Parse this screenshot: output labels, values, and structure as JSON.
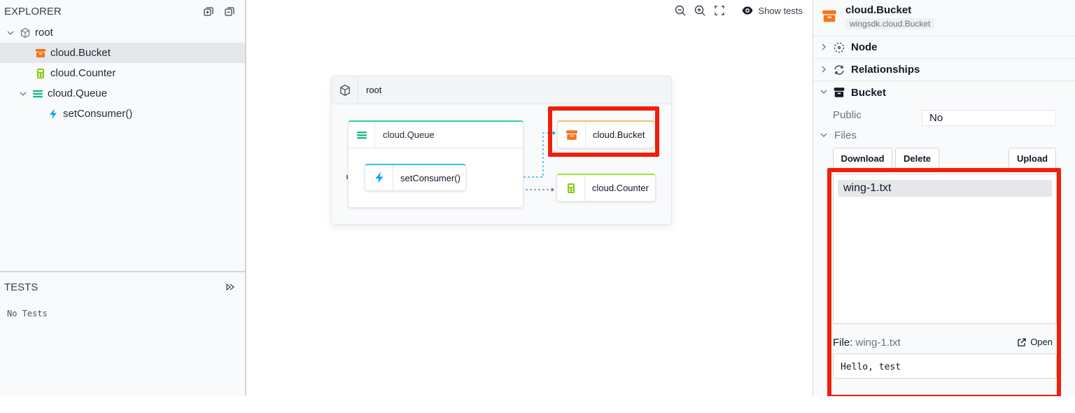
{
  "explorer": {
    "title": "EXPLORER",
    "items": [
      {
        "label": "root"
      },
      {
        "label": "cloud.Bucket"
      },
      {
        "label": "cloud.Counter"
      },
      {
        "label": "cloud.Queue"
      },
      {
        "label": "setConsumer()"
      }
    ]
  },
  "tests": {
    "title": "TESTS",
    "empty": "No Tests"
  },
  "toolbar": {
    "show_tests": "Show tests"
  },
  "map": {
    "root": "root",
    "queue": "cloud.Queue",
    "consumer": "setConsumer()",
    "bucket": "cloud.Bucket",
    "counter": "cloud.Counter"
  },
  "inspector": {
    "title": "cloud.Bucket",
    "subtitle": "wingsdk.cloud.Bucket",
    "sections": {
      "node": "Node",
      "relationships": "Relationships",
      "bucket": "Bucket"
    },
    "public_label": "Public",
    "public_value": "No",
    "files_label": "Files",
    "buttons": {
      "download": "Download",
      "delete": "Delete",
      "upload": "Upload"
    },
    "files": [
      "wing-1.txt"
    ],
    "file_prefix": "File:",
    "file_name": "wing-1.txt",
    "open": "Open",
    "file_content": "Hello, test"
  },
  "colors": {
    "bucket": "#f97316",
    "counter": "#84cc16",
    "queue": "#10b981",
    "function": "#0ea5e9",
    "highlight": "#f01e0a"
  }
}
